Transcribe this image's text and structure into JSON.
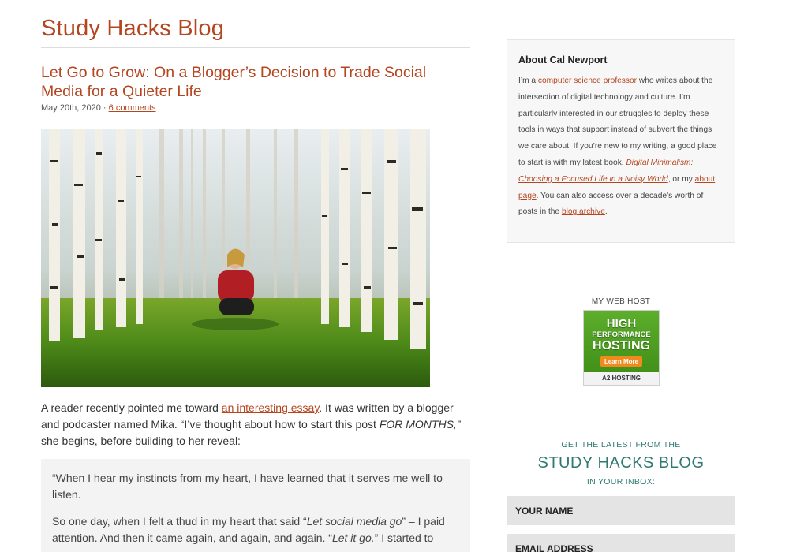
{
  "blog": {
    "title": "Study Hacks Blog"
  },
  "post": {
    "title": "Let Go to Grow: On a Blogger’s Decision to Trade Social Media for a Quieter Life",
    "date": "May 20th, 2020",
    "separator": "·",
    "comments_link": "6 comments",
    "photo_description": "Woman sitting in a birch forest looking up",
    "intro_1": "A reader recently pointed me toward ",
    "intro_link": "an interesting essay",
    "intro_2": ". It was written by a blogger and podcaster named Mika. “I’ve thought about how to start this post ",
    "intro_em": "FOR MONTHS,”",
    "intro_3": " she begins, before building to her reveal:",
    "quote_p1": "“When I hear my instincts from my heart, I have learned that it serves me well to listen.",
    "quote_p2a": "So one day, when I felt a thud in my heart that said “",
    "quote_p2_em1": "Let social media go",
    "quote_p2b": "” – I paid attention. And then it came again, and again, and again. “",
    "quote_p2_em2": "Let it go.",
    "quote_p2c": "” I started to"
  },
  "sidebar": {
    "about": {
      "heading": "About Cal Newport",
      "t1": "I’m a ",
      "l1": "computer science professor",
      "t2": " who writes about the intersection of digital technology and culture. I’m particularly interested in our struggles to deploy these tools in ways that support instead of subvert the things we care about. If you’re new to my writing, a good place to start is with my latest book, ",
      "l2": "Digital Minimalism: Choosing a Focused Life in a Noisy World",
      "t3": ", or my ",
      "l3": "about page",
      "t4": ". You can also access over a decade’s worth of posts in the ",
      "l4": "blog archive",
      "t5": "."
    },
    "host": {
      "label": "MY WEB HOST",
      "ad_line1": "HIGH",
      "ad_line2": "PERFORMANCE",
      "ad_line3": "HOSTING",
      "ad_button": "Learn More",
      "ad_brand": "A2 HOSTING"
    },
    "signup": {
      "top": "GET THE LATEST FROM THE",
      "title": "STUDY HACKS BLOG",
      "bottom": "IN YOUR INBOX:",
      "name_placeholder": "YOUR NAME",
      "email_placeholder": "EMAIL ADDRESS"
    }
  },
  "colors": {
    "accent": "#b5451f",
    "teal": "#2e7a72"
  },
  "icons": []
}
